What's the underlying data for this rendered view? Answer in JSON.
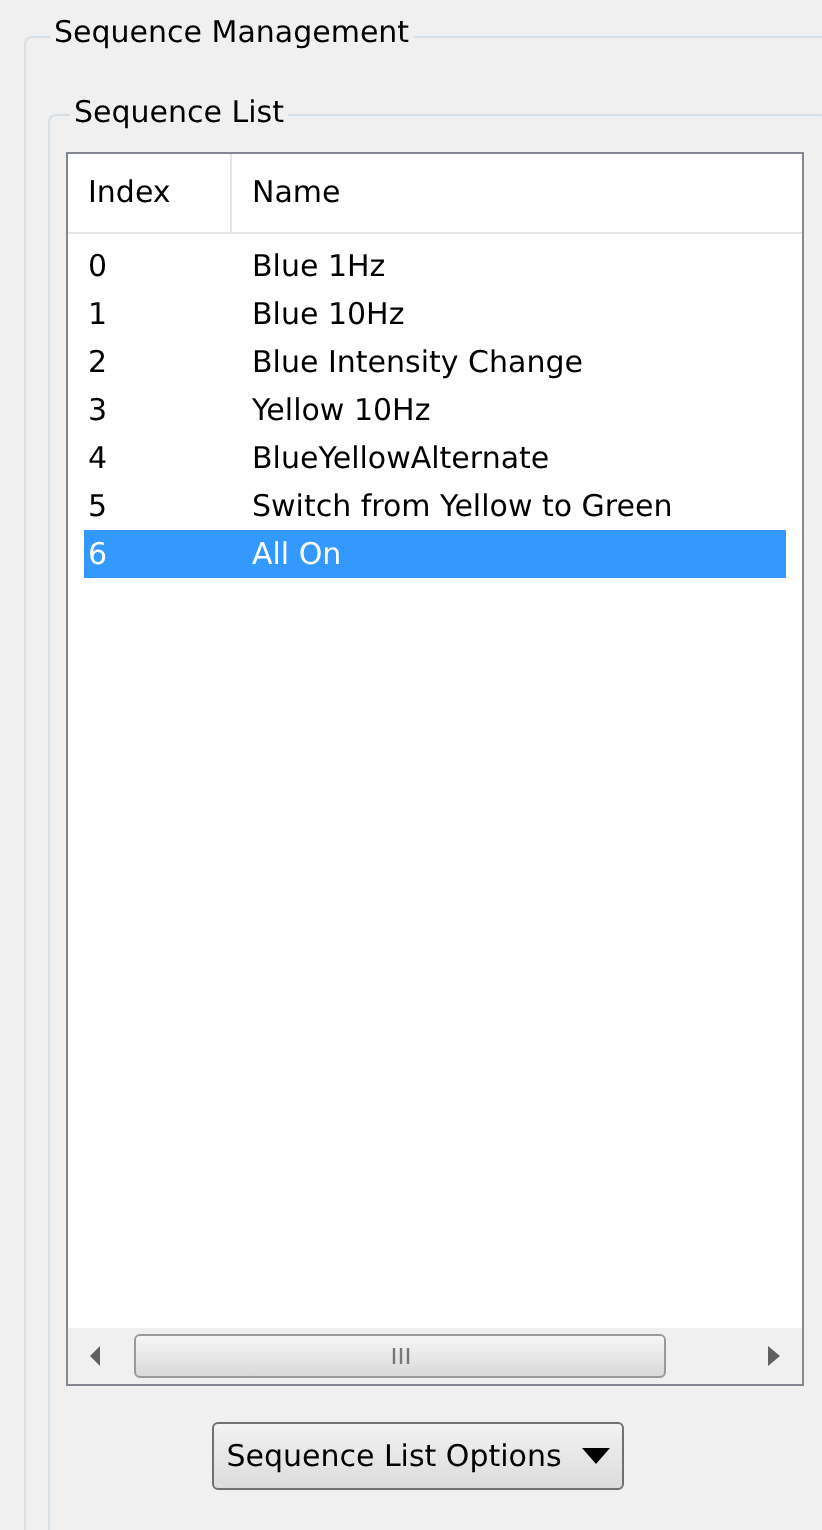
{
  "group": {
    "title": "Sequence Management"
  },
  "sequence_list": {
    "title": "Sequence List",
    "columns": [
      "Index",
      "Name"
    ],
    "rows": [
      {
        "index": "0",
        "name": "Blue 1Hz",
        "selected": false
      },
      {
        "index": "1",
        "name": "Blue 10Hz",
        "selected": false
      },
      {
        "index": "2",
        "name": "Blue Intensity Change",
        "selected": false
      },
      {
        "index": "3",
        "name": "Yellow 10Hz",
        "selected": false
      },
      {
        "index": "4",
        "name": "BlueYellowAlternate",
        "selected": false
      },
      {
        "index": "5",
        "name": "Switch from Yellow to Green",
        "selected": false
      },
      {
        "index": "6",
        "name": "All On",
        "selected": true
      }
    ],
    "options_button": "Sequence List Options"
  }
}
